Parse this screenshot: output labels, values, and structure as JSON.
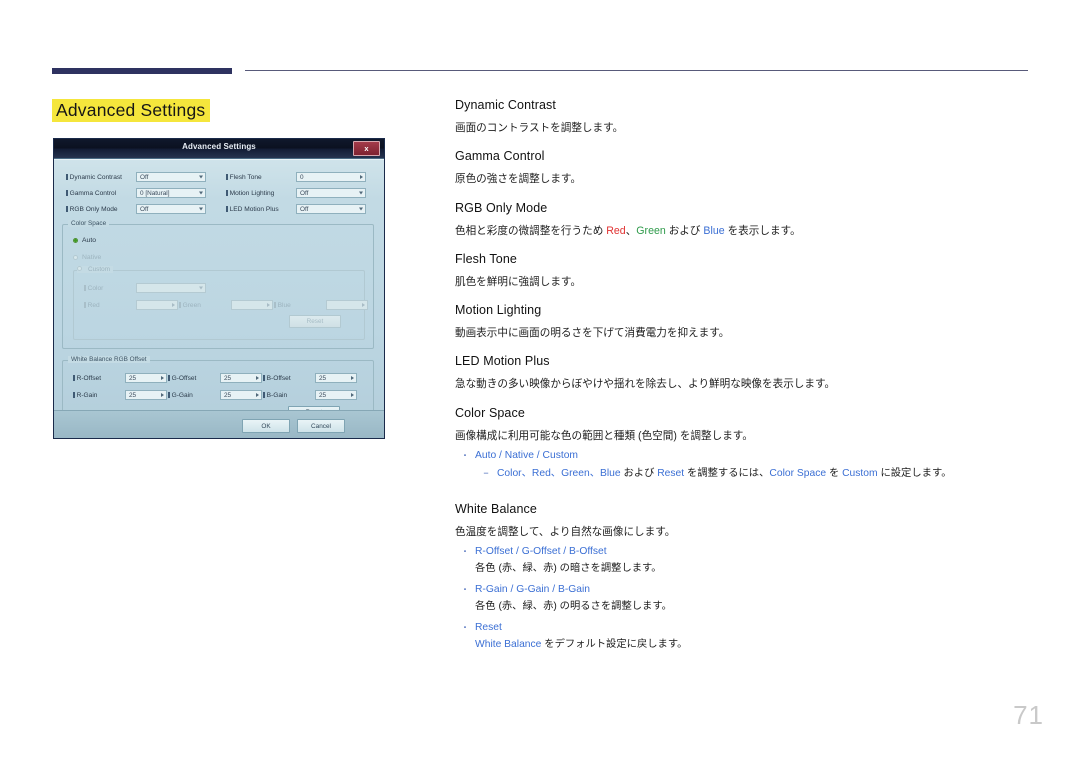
{
  "page": {
    "title": "Advanced Settings",
    "number": "71"
  },
  "dialog": {
    "title": "Advanced Settings",
    "close_label": "x",
    "rows": [
      {
        "label": "Dynamic Contrast",
        "value": "Off",
        "type": "select"
      },
      {
        "label": "Flesh Tone",
        "value": "0",
        "type": "spinner"
      },
      {
        "label": "Gamma Control",
        "value": "0 [Natural]",
        "type": "select"
      },
      {
        "label": "Motion Lighting",
        "value": "Off",
        "type": "select"
      },
      {
        "label": "RGB Only Mode",
        "value": "Off",
        "type": "select"
      },
      {
        "label": "LED Motion Plus",
        "value": "Off",
        "type": "select"
      }
    ],
    "color_space": {
      "legend": "Color Space",
      "options": [
        {
          "label": "Auto",
          "selected": true
        },
        {
          "label": "Native",
          "selected": false
        },
        {
          "label": "Custom",
          "selected": false
        }
      ],
      "custom": {
        "legend": "Custom",
        "color_label": "Color",
        "color_value": "",
        "red_label": "Red",
        "red_value": "",
        "green_label": "Green",
        "green_value": "",
        "blue_label": "Blue",
        "blue_value": "",
        "reset_label": "Reset"
      }
    },
    "white_balance": {
      "legend": "White Balance RGB Offset",
      "fields": [
        {
          "label": "R-Offset",
          "value": "25"
        },
        {
          "label": "G-Offset",
          "value": "25"
        },
        {
          "label": "B-Offset",
          "value": "25"
        },
        {
          "label": "R-Gain",
          "value": "25"
        },
        {
          "label": "G-Gain",
          "value": "25"
        },
        {
          "label": "B-Gain",
          "value": "25"
        }
      ],
      "reset_label": "Reset"
    },
    "footer": {
      "ok_label": "OK",
      "cancel_label": "Cancel"
    }
  },
  "sections": {
    "dynamic_contrast": {
      "title": "Dynamic Contrast",
      "desc": "画面のコントラストを調整します。"
    },
    "gamma_control": {
      "title": "Gamma Control",
      "desc": "原色の強さを調整します。"
    },
    "rgb_only_mode": {
      "title": "RGB Only Mode",
      "desc_1": "色相と彩度の微調整を行うため ",
      "red": "Red",
      "sep_1": "、",
      "green": "Green",
      "desc_2": " および ",
      "blue": "Blue",
      "desc_3": " を表示します。"
    },
    "flesh_tone": {
      "title": "Flesh Tone",
      "desc": "肌色を鮮明に強調します。"
    },
    "motion_lighting": {
      "title": "Motion Lighting",
      "desc": "動画表示中に画面の明るさを下げて消費電力を抑えます。"
    },
    "led_motion_plus": {
      "title": "LED Motion Plus",
      "desc": "急な動きの多い映像からぼやけや揺れを除去し、より鮮明な映像を表示します。"
    },
    "color_space": {
      "title": "Color Space",
      "desc": "画像構成に利用可能な色の範囲と種類 (色空間) を調整します。",
      "bullet_1": "Auto / Native / Custom",
      "sub_1_a": "Color、Red、Green、Blue",
      "sub_1_b": " および ",
      "sub_1_c": "Reset",
      "sub_1_d": " を調整するには、",
      "sub_1_e": "Color Space",
      "sub_1_f": " を ",
      "sub_1_g": "Custom",
      "sub_1_h": " に設定します。"
    },
    "white_balance": {
      "title": "White Balance",
      "desc": "色温度を調整して、より自然な画像にします。",
      "bullet_1": "R-Offset / G-Offset / B-Offset",
      "bullet_1_desc": "各色 (赤、緑、赤) の暗さを調整します。",
      "bullet_2": "R-Gain / G-Gain / B-Gain",
      "bullet_2_desc": "各色 (赤、緑、赤) の明るさを調整します。",
      "bullet_3": "Reset",
      "bullet_3_link": "White Balance",
      "bullet_3_desc": " をデフォルト設定に戻します。"
    }
  },
  "markers": {
    "bullet": "・",
    "dash": "−"
  }
}
